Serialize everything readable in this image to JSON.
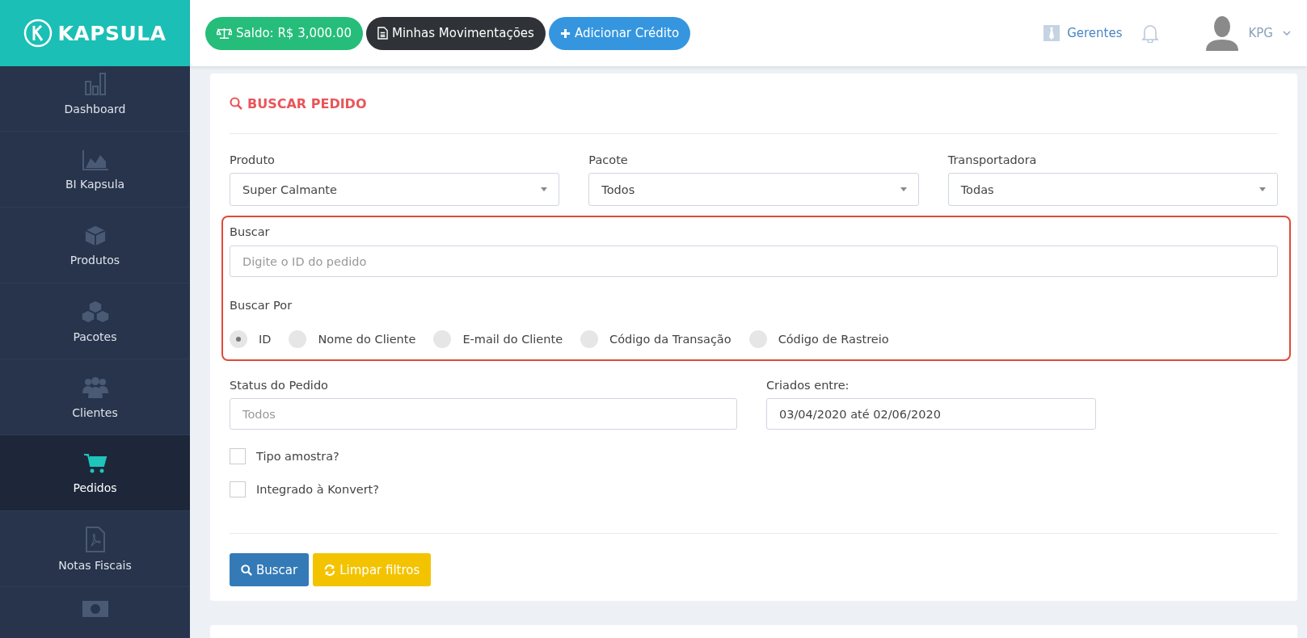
{
  "brand": {
    "name": "KAPSULA"
  },
  "topbar": {
    "buttons": [
      {
        "kind": "balance",
        "label": "Saldo: R$ 3,000.00"
      },
      {
        "kind": "statement",
        "label": "Minhas Movimentações"
      },
      {
        "kind": "add",
        "label": "Adicionar Crédito"
      }
    ],
    "managers_link": "Gerentes",
    "user": "KPG"
  },
  "sidebar": {
    "items": [
      {
        "kind": "dashboard",
        "label": "Dashboard",
        "selected": false
      },
      {
        "kind": "chart",
        "label": "BI Kapsula",
        "selected": false
      },
      {
        "kind": "cube",
        "label": "Produtos",
        "selected": false
      },
      {
        "kind": "cubes",
        "label": "Pacotes",
        "selected": false
      },
      {
        "kind": "users",
        "label": "Clientes",
        "selected": false
      },
      {
        "kind": "cart",
        "label": "Pedidos",
        "selected": true
      },
      {
        "kind": "pdf",
        "label": "Notas Fiscais",
        "selected": false
      },
      {
        "kind": "money",
        "selected": false
      }
    ]
  },
  "search_card": {
    "title": "BUSCAR PEDIDO",
    "selects": [
      {
        "label": "Produto",
        "value": "Super Calmante"
      },
      {
        "label": "Pacote",
        "value": "Todos"
      },
      {
        "label": "Transportadora",
        "value": "Todas"
      }
    ],
    "search": {
      "label": "Buscar",
      "placeholder": "Digite o ID do pedido"
    },
    "search_by": {
      "label": "Buscar Por",
      "options": [
        {
          "label": "ID",
          "selected": true
        },
        {
          "label": "Nome do Cliente",
          "selected": false
        },
        {
          "label": "E-mail do Cliente",
          "selected": false
        },
        {
          "label": "Código da Transação",
          "selected": false
        },
        {
          "label": "Código de Rastreio",
          "selected": false
        }
      ]
    },
    "status": {
      "label": "Status do Pedido",
      "placeholder": "Todos"
    },
    "created": {
      "label": "Criados entre:",
      "value": "03/04/2020 até 02/06/2020"
    },
    "checkboxes": [
      {
        "label": "Tipo amostra?",
        "checked": false
      },
      {
        "label": "Integrado à Konvert?",
        "checked": false
      }
    ],
    "actions": [
      {
        "kind": "search",
        "label": "Buscar"
      },
      {
        "kind": "reset",
        "label": "Limpar filtros"
      }
    ]
  }
}
